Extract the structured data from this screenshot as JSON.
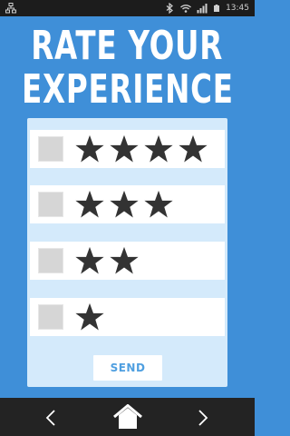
{
  "status_bar": {
    "time": "13:45",
    "left_icon": "network-icon",
    "right_icons": [
      "bluetooth-icon",
      "wifi-icon",
      "signal-icon",
      "battery-icon"
    ]
  },
  "title": {
    "line1": "RATE YOUR",
    "line2": "EXPERIENCE"
  },
  "ratings": [
    {
      "stars": 4,
      "checked": false
    },
    {
      "stars": 3,
      "checked": false
    },
    {
      "stars": 2,
      "checked": false
    },
    {
      "stars": 1,
      "checked": false
    }
  ],
  "send_label": "SEND",
  "nav_icons": [
    "back-icon",
    "home-icon",
    "forward-icon"
  ],
  "colors": {
    "background": "#3f8fd8",
    "panel": "#d4eafb",
    "star": "#333333",
    "button_text": "#4f9fe0"
  }
}
